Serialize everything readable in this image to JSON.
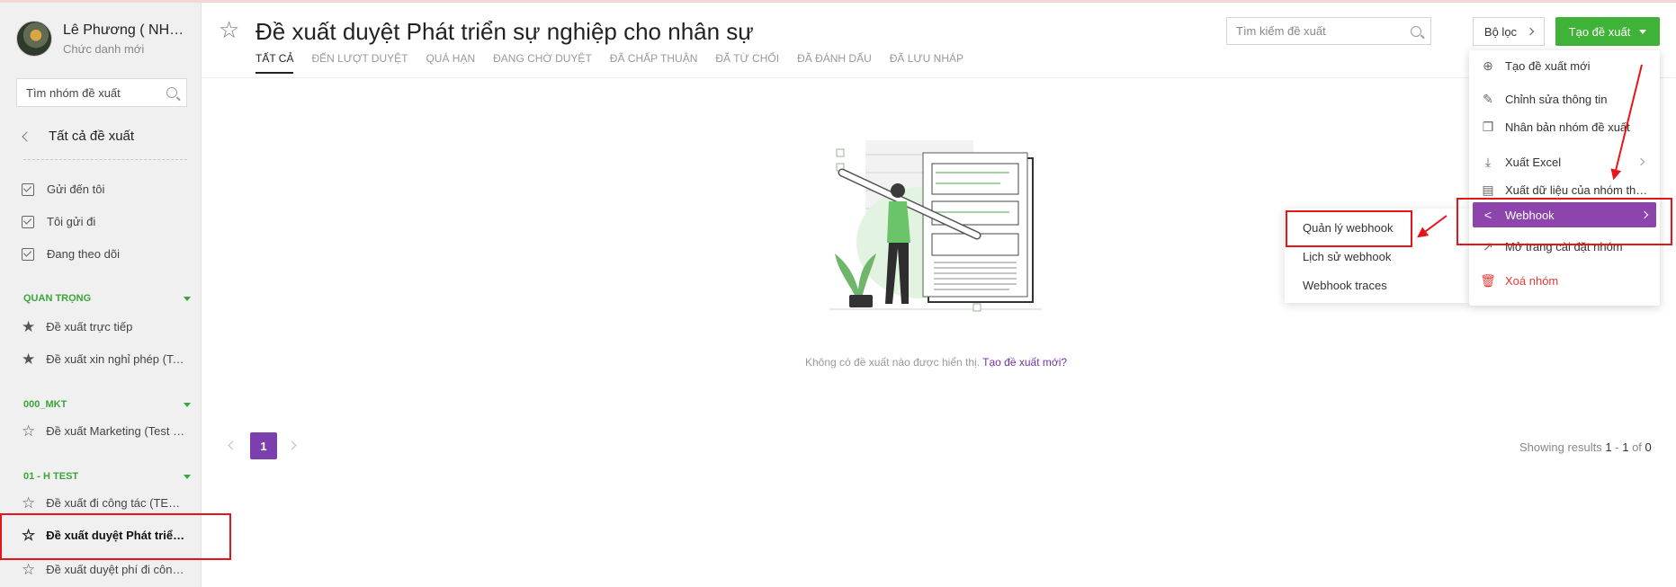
{
  "user": {
    "name": "Lê Phương ( NHÂN SỰ )",
    "role": "Chức danh mới"
  },
  "sidebar": {
    "search_placeholder": "Tìm nhóm đề xuất",
    "back_label": "Tất cả đề xuất",
    "filters": [
      "Gửi đến tôi",
      "Tôi gửi đi",
      "Đang theo dõi"
    ],
    "groups": [
      {
        "title": "QUAN TRỌNG",
        "items": [
          "Đề xuất trực tiếp",
          "Đề xuất xin nghỉ phép (Test)"
        ]
      },
      {
        "title": "000_MKT",
        "items": [
          "Đề xuất Marketing (Test chi phí)"
        ]
      },
      {
        "title": "01 - H TEST",
        "items": [
          "Đề xuất đi công tác (TEST)",
          "Đề xuất duyệt Phát triển sự nghiệp cho nhân sự",
          "Đề xuất duyệt phí đi công tác"
        ]
      }
    ]
  },
  "header": {
    "title": "Đề xuất duyệt Phát triển sự nghiệp cho nhân sự",
    "tabs": [
      "TẤT CẢ",
      "ĐẾN LƯỢT DUYỆT",
      "QUÁ HẠN",
      "ĐANG CHỜ DUYỆT",
      "ĐÃ CHẤP THUẬN",
      "ĐÃ TỪ CHỐI",
      "ĐÃ ĐÁNH DẤU",
      "ĐÃ LƯU NHÁP"
    ],
    "search_placeholder": "Tìm kiếm đề xuất",
    "filter_label": "Bộ lọc",
    "create_label": "Tạo đề xuất"
  },
  "empty": {
    "message": "Không có đề xuất nào được hiển thị.",
    "link": "Tạo đề xuất mới?"
  },
  "pagination": {
    "current": "1",
    "results_prefix": "Showing results",
    "from": "1",
    "to": "1",
    "of_label": "of",
    "total": "0"
  },
  "dropdown": {
    "items": [
      {
        "label": "Tạo đề xuất mới",
        "icon": "plus-circle-icon"
      },
      {
        "label": "Chỉnh sửa thông tin",
        "icon": "edit-icon"
      },
      {
        "label": "Nhân bản nhóm đề xuất",
        "icon": "copy-icon"
      },
      {
        "label": "Xuất Excel",
        "icon": "download-icon"
      },
      {
        "label": "Xuất dữ liệu của nhóm theo mẫu",
        "icon": "document-icon"
      },
      {
        "label": "Webhook",
        "icon": "share-icon"
      },
      {
        "label": "Mở trang cài đặt nhóm",
        "icon": "external-link-icon"
      },
      {
        "label": "Xoá nhóm",
        "icon": "trash-icon"
      }
    ]
  },
  "submenu": {
    "items": [
      "Quản lý webhook",
      "Lịch sử webhook",
      "Webhook traces"
    ]
  },
  "colors": {
    "primary": "#3fb238",
    "accent": "#8e44ad",
    "danger": "#e53935",
    "annotation": "#e8141c"
  }
}
